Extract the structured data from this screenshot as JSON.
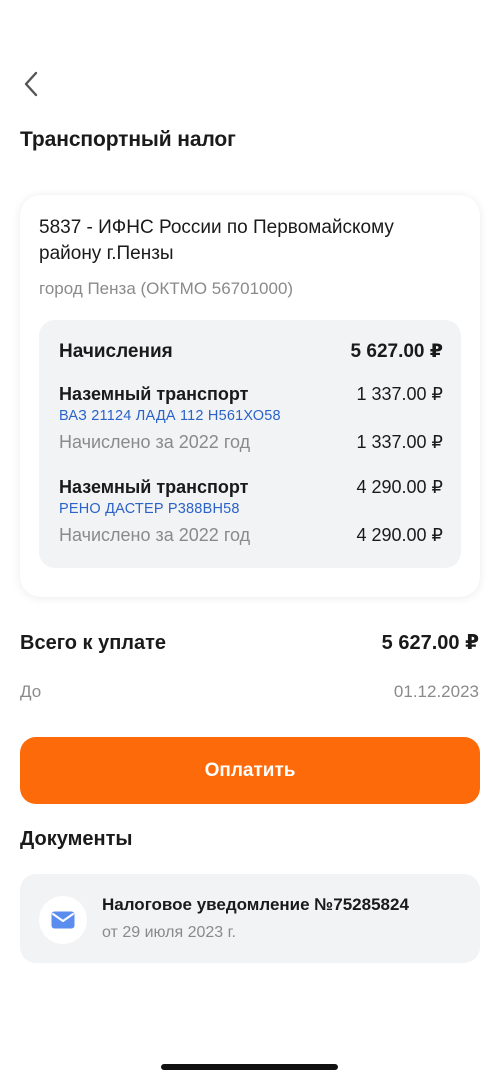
{
  "page": {
    "title": "Транспортный налог"
  },
  "card": {
    "organization": "5837 - ИФНС России по Первомайскому району г.Пензы",
    "city": "город Пенза (ОКТМО 56701000)"
  },
  "charges": {
    "title": "Начисления",
    "total": "5 627.00 ₽",
    "items": [
      {
        "title": "Наземный транспорт",
        "amount": "1 337.00 ₽",
        "vehicle": "ВАЗ 21124 ЛАДА 112 Н561ХО58",
        "period": "Начислено за 2022 год",
        "period_amount": "1 337.00 ₽"
      },
      {
        "title": "Наземный транспорт",
        "amount": "4 290.00 ₽",
        "vehicle": "РЕНО ДАСТЕР Р388ВН58",
        "period": "Начислено за 2022 год",
        "period_amount": "4 290.00 ₽"
      }
    ]
  },
  "summary": {
    "total_label": "Всего к уплате",
    "total_value": "5 627.00 ₽",
    "due_label": "До",
    "due_value": "01.12.2023"
  },
  "actions": {
    "pay_label": "Оплатить"
  },
  "documents": {
    "title": "Документы",
    "items": [
      {
        "name": "Налоговое уведомление №75285824",
        "date": "от 29 июля 2023 г.",
        "icon": "envelope-icon"
      }
    ]
  },
  "colors": {
    "accent": "#fc6a0a",
    "link": "#2a62c9",
    "muted": "#8a8a8a",
    "surface": "#f2f3f5"
  }
}
